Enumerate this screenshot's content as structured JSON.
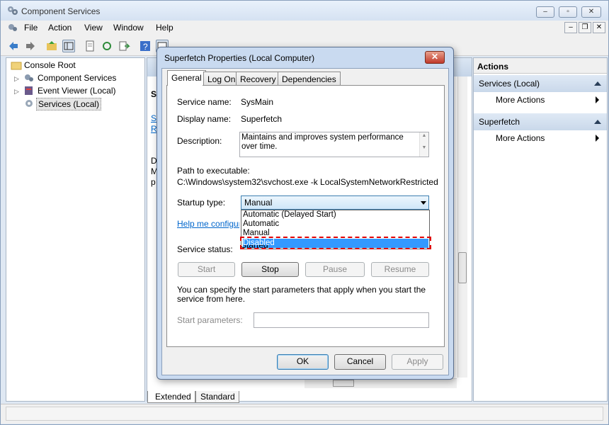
{
  "window": {
    "title": "Component Services",
    "minimize": "‒",
    "maximize": "▫",
    "close": "✕"
  },
  "menu": [
    "File",
    "Action",
    "View",
    "Window",
    "Help"
  ],
  "tree": {
    "items": [
      "Console Root",
      "Component Services",
      "Event Viewer (Local)",
      "Services (Local)"
    ]
  },
  "middle": {
    "heading_fragment": "S",
    "link_fragments": [
      "S",
      "R"
    ],
    "text_fragments": [
      "D",
      "M",
      "p"
    ],
    "tabs": [
      "Extended",
      "Standard"
    ]
  },
  "actions": {
    "title": "Actions",
    "groups": [
      {
        "label": "Services (Local)",
        "item": "More Actions"
      },
      {
        "label": "Superfetch",
        "item": "More Actions"
      }
    ]
  },
  "dialog": {
    "title": "Superfetch Properties (Local Computer)",
    "tabs": [
      "General",
      "Log On",
      "Recovery",
      "Dependencies"
    ],
    "service_name_label": "Service name:",
    "service_name": "SysMain",
    "display_name_label": "Display name:",
    "display_name": "Superfetch",
    "description_label": "Description:",
    "description": "Maintains and improves system performance over time.",
    "path_label": "Path to executable:",
    "path": "C:\\Windows\\system32\\svchost.exe -k LocalSystemNetworkRestricted",
    "startup_label": "Startup type:",
    "startup_value": "Manual",
    "startup_options": [
      "Automatic (Delayed Start)",
      "Automatic",
      "Manual",
      "Disabled"
    ],
    "highlighted_option": "Disabled",
    "help_link": "Help me configure s",
    "status_label": "Service status:",
    "status_value": "Started",
    "buttons": {
      "start": "Start",
      "stop": "Stop",
      "pause": "Pause",
      "resume": "Resume"
    },
    "params_note": "You can specify the start parameters that apply when you start the service from here.",
    "params_label": "Start parameters:",
    "params_value": "",
    "ok": "OK",
    "cancel": "Cancel",
    "apply": "Apply"
  },
  "colors": {
    "accent_blue": "#3399ff",
    "highlight_red": "#e00000",
    "link": "#0066cc"
  }
}
